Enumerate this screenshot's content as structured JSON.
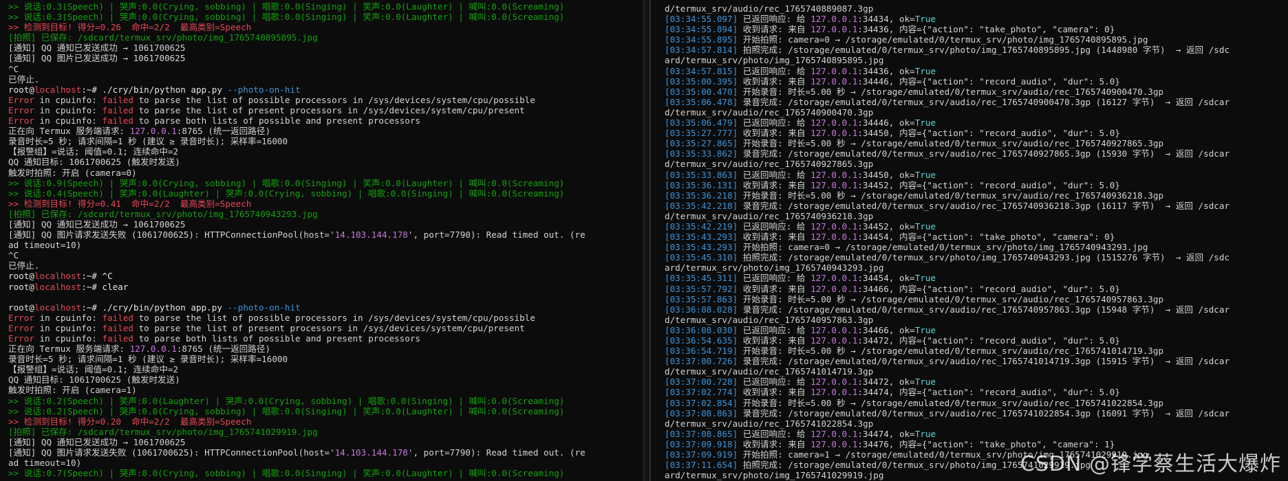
{
  "left": {
    "lines": [
      {
        "t": "g",
        "s": ">> 说话:0.3(Speech) | 哭声:0.0(Crying, sobbing) | 唱歌:0.0(Singing) | 笑声:0.0(Laughter) | 喊叫:0.0(Screaming)"
      },
      {
        "t": "g",
        "s": ">> 说话:0.3(Speech) | 哭声:0.0(Crying, sobbing) | 唱歌:0.0(Singing) | 笑声:0.0(Laughter) | 喊叫:0.0(Screaming)"
      },
      {
        "t": "r",
        "s": ">> 检测到目标! 得分=0.26  命中=2/2  最高类别=Speech"
      },
      {
        "t": "g",
        "s": "[拍照] 已保存: /sdcard/termux_srv/photo/img_1765740895895.jpg"
      },
      {
        "t": "w",
        "s": "[通知] QQ 通知已发送成功 → 1061700625"
      },
      {
        "t": "w",
        "s": "[通知] QQ 图片已发送成功 → 1061700625"
      },
      {
        "t": "w",
        "s": "^C"
      },
      {
        "t": "w",
        "s": "已停止."
      },
      {
        "t": "prompt",
        "user": "root",
        "host": "localhost",
        "path": ":~#",
        "cmd": " ./cry/bin/python app.py ",
        "flag": "--photo-on-hit"
      },
      {
        "t": "err",
        "s": " in cpuinfo: ",
        "f": "failed",
        "rest": " to parse the list of possible processors in /sys/devices/system/cpu/possible"
      },
      {
        "t": "err",
        "s": " in cpuinfo: ",
        "f": "failed",
        "rest": " to parse the list of present processors in /sys/devices/system/cpu/present"
      },
      {
        "t": "err",
        "s": " in cpuinfo: ",
        "f": "failed",
        "rest": " to parse both lists of possible and present processors"
      },
      {
        "t": "ip",
        "a": "正在向 Termux 服务端请求: ",
        "ip": "127.0.0.1",
        "b": ":8765 (统一返回路径)"
      },
      {
        "t": "w",
        "s": "录音时长=5 秒; 请求间隔=1 秒 (建议 ≥ 录音时长); 采样率=16000"
      },
      {
        "t": "w",
        "s": "【报警组】=说话; 阈值=0.1; 连续命中=2"
      },
      {
        "t": "w",
        "s": "QQ 通知目标: 1061700625 (触发时发送)"
      },
      {
        "t": "w",
        "s": "触发时拍照: 开启 (camera=0)"
      },
      {
        "t": "g",
        "s": ">> 说话:0.9(Speech) | 哭声:0.0(Crying, sobbing) | 唱歌:0.0(Singing) | 笑声:0.0(Laughter) | 喊叫:0.0(Screaming)"
      },
      {
        "t": "g",
        "s": ">> 说话:0.4(Speech) | 笑声:0.0(Laughter) | 哭声:0.0(Crying, sobbing) | 唱歌:0.0(Singing) | 喊叫:0.0(Screaming)"
      },
      {
        "t": "r",
        "s": ">> 检测到目标! 得分=0.41  命中=2/2  最高类别=Speech"
      },
      {
        "t": "g",
        "s": "[拍照] 已保存: /sdcard/termux_srv/photo/img_1765740943293.jpg"
      },
      {
        "t": "w",
        "s": "[通知] QQ 通知已发送成功 → 1061700625"
      },
      {
        "t": "ip2",
        "a": "[通知] QQ 图片请求发送失败 (1061700625): HTTPConnectionPool(host='",
        "ip": "14.103.144.178",
        "b": "', port=7790): Read timed out. (re"
      },
      {
        "t": "w",
        "s": "ad timeout=10)"
      },
      {
        "t": "w",
        "s": "^C"
      },
      {
        "t": "w",
        "s": "已停止."
      },
      {
        "t": "prompt0",
        "user": "root",
        "host": "localhost",
        "path": ":~#",
        "cmd": " ^C"
      },
      {
        "t": "prompt0",
        "user": "root",
        "host": "localhost",
        "path": ":~#",
        "cmd": " clear"
      },
      {
        "t": "w",
        "s": ""
      },
      {
        "t": "prompt",
        "user": "root",
        "host": "localhost",
        "path": ":~#",
        "cmd": " ./cry/bin/python app.py ",
        "flag": "--photo-on-hit"
      },
      {
        "t": "err",
        "s": " in cpuinfo: ",
        "f": "failed",
        "rest": " to parse the list of possible processors in /sys/devices/system/cpu/possible"
      },
      {
        "t": "err",
        "s": " in cpuinfo: ",
        "f": "failed",
        "rest": " to parse the list of present processors in /sys/devices/system/cpu/present"
      },
      {
        "t": "err",
        "s": " in cpuinfo: ",
        "f": "failed",
        "rest": " to parse both lists of possible and present processors"
      },
      {
        "t": "ip",
        "a": "正在向 Termux 服务端请求: ",
        "ip": "127.0.0.1",
        "b": ":8765 (统一返回路径)"
      },
      {
        "t": "w",
        "s": "录音时长=5 秒; 请求间隔=1 秒 (建议 ≥ 录音时长); 采样率=16000"
      },
      {
        "t": "w",
        "s": "【报警组】=说话; 阈值=0.1; 连续命中=2"
      },
      {
        "t": "w",
        "s": "QQ 通知目标: 1061700625 (触发时发送)"
      },
      {
        "t": "w",
        "s": "触发时拍照: 开启 (camera=1)"
      },
      {
        "t": "g",
        "s": ">> 说话:0.2(Speech) | 笑声:0.0(Laughter) | 哭声:0.0(Crying, sobbing) | 唱歌:0.0(Singing) | 喊叫:0.0(Screaming)"
      },
      {
        "t": "g",
        "s": ">> 说话:0.2(Speech) | 哭声:0.0(Crying, sobbing) | 唱歌:0.0(Singing) | 笑声:0.0(Laughter) | 喊叫:0.0(Screaming)"
      },
      {
        "t": "r",
        "s": ">> 检测到目标! 得分=0.20  命中=2/2  最高类别=Speech"
      },
      {
        "t": "g",
        "s": "[拍照] 已保存: /sdcard/termux_srv/photo/img_1765741029919.jpg"
      },
      {
        "t": "w",
        "s": "[通知] QQ 通知已发送成功 → 1061700625"
      },
      {
        "t": "ip2",
        "a": "[通知] QQ 图片请求发送失败 (1061700625): HTTPConnectionPool(host='",
        "ip": "14.103.144.178",
        "b": "', port=7790): Read timed out. (re"
      },
      {
        "t": "w",
        "s": "ad timeout=10)"
      },
      {
        "t": "g",
        "s": ">> 说话:0.7(Speech) | 哭声:0.0(Crying, sobbing) | 唱歌:0.0(Singing) | 笑声:0.0(Laughter) | 喊叫:0.0(Screaming)"
      }
    ]
  },
  "right": {
    "lines": [
      {
        "t": "w",
        "s": "d/termux_srv/audio/rec_1765740889087.3gp"
      },
      {
        "t": "log",
        "ts": "[03:34:55.097]",
        "a": " 已返回响应: 给 ",
        "ip": "127.0.0.1",
        "b": ":34434, ok=",
        "ok": "True"
      },
      {
        "t": "log",
        "ts": "[03:34:55.894]",
        "a": " 收到请求: 来自 ",
        "ip": "127.0.0.1",
        "b": ":34436, 内容={\"action\": \"take_photo\", \"camera\": 0}"
      },
      {
        "t": "log",
        "ts": "[03:34:55.895]",
        "a": " 开始拍照: camera=0 → /storage/emulated/0/termux_srv/photo/img_1765740895895.jpg"
      },
      {
        "t": "log",
        "ts": "[03:34:57.814]",
        "a": " 拍照完成: /storage/emulated/0/termux_srv/photo/img_1765740895895.jpg (1448980 字节)  → 返回 /sdc"
      },
      {
        "t": "w",
        "s": "ard/termux_srv/photo/img_1765740895895.jpg"
      },
      {
        "t": "log",
        "ts": "[03:34:57.815]",
        "a": " 已返回响应: 给 ",
        "ip": "127.0.0.1",
        "b": ":34436, ok=",
        "ok": "True"
      },
      {
        "t": "log",
        "ts": "[03:35:00.395]",
        "a": " 收到请求: 来自 ",
        "ip": "127.0.0.1",
        "b": ":34446, 内容={\"action\": \"record_audio\", \"dur\": 5.0}"
      },
      {
        "t": "log",
        "ts": "[03:35:00.470]",
        "a": " 开始录音: 时长=5.00 秒 → /storage/emulated/0/termux_srv/audio/rec_1765740900470.3gp"
      },
      {
        "t": "log",
        "ts": "[03:35:06.478]",
        "a": " 录音完成: /storage/emulated/0/termux_srv/audio/rec_1765740900470.3gp (16127 字节)  → 返回 /sdcar"
      },
      {
        "t": "w",
        "s": "d/termux_srv/audio/rec_1765740900470.3gp"
      },
      {
        "t": "log",
        "ts": "[03:35:06.479]",
        "a": " 已返回响应: 给 ",
        "ip": "127.0.0.1",
        "b": ":34446, ok=",
        "ok": "True"
      },
      {
        "t": "log",
        "ts": "[03:35:27.777]",
        "a": " 收到请求: 来自 ",
        "ip": "127.0.0.1",
        "b": ":34450, 内容={\"action\": \"record_audio\", \"dur\": 5.0}"
      },
      {
        "t": "log",
        "ts": "[03:35:27.865]",
        "a": " 开始录音: 时长=5.00 秒 → /storage/emulated/0/termux_srv/audio/rec_1765740927865.3gp"
      },
      {
        "t": "log",
        "ts": "[03:35:33.862]",
        "a": " 录音完成: /storage/emulated/0/termux_srv/audio/rec_1765740927865.3gp (15930 字节)  → 返回 /sdcar"
      },
      {
        "t": "w",
        "s": "d/termux_srv/audio/rec_1765740927865.3gp"
      },
      {
        "t": "log",
        "ts": "[03:35:33.863]",
        "a": " 已返回响应: 给 ",
        "ip": "127.0.0.1",
        "b": ":34450, ok=",
        "ok": "True"
      },
      {
        "t": "log",
        "ts": "[03:35:36.131]",
        "a": " 收到请求: 来自 ",
        "ip": "127.0.0.1",
        "b": ":34452, 内容={\"action\": \"record_audio\", \"dur\": 5.0}"
      },
      {
        "t": "log",
        "ts": "[03:35:36.218]",
        "a": " 开始录音: 时长=5.00 秒 → /storage/emulated/0/termux_srv/audio/rec_1765740936218.3gp"
      },
      {
        "t": "log",
        "ts": "[03:35:42.218]",
        "a": " 录音完成: /storage/emulated/0/termux_srv/audio/rec_1765740936218.3gp (16117 字节)  → 返回 /sdcar"
      },
      {
        "t": "w",
        "s": "d/termux_srv/audio/rec_1765740936218.3gp"
      },
      {
        "t": "log",
        "ts": "[03:35:42.219]",
        "a": " 已返回响应: 给 ",
        "ip": "127.0.0.1",
        "b": ":34452, ok=",
        "ok": "True"
      },
      {
        "t": "log",
        "ts": "[03:35:43.293]",
        "a": " 收到请求: 来自 ",
        "ip": "127.0.0.1",
        "b": ":34454, 内容={\"action\": \"take_photo\", \"camera\": 0}"
      },
      {
        "t": "log",
        "ts": "[03:35:43.293]",
        "a": " 开始拍照: camera=0 → /storage/emulated/0/termux_srv/photo/img_1765740943293.jpg"
      },
      {
        "t": "log",
        "ts": "[03:35:45.310]",
        "a": " 拍照完成: /storage/emulated/0/termux_srv/photo/img_1765740943293.jpg (1515276 字节)  → 返回 /sdc"
      },
      {
        "t": "w",
        "s": "ard/termux_srv/photo/img_1765740943293.jpg"
      },
      {
        "t": "log",
        "ts": "[03:35:45.311]",
        "a": " 已返回响应: 给 ",
        "ip": "127.0.0.1",
        "b": ":34454, ok=",
        "ok": "True"
      },
      {
        "t": "log",
        "ts": "[03:35:57.792]",
        "a": " 收到请求: 来自 ",
        "ip": "127.0.0.1",
        "b": ":34466, 内容={\"action\": \"record_audio\", \"dur\": 5.0}"
      },
      {
        "t": "log",
        "ts": "[03:35:57.863]",
        "a": " 开始录音: 时长=5.00 秒 → /storage/emulated/0/termux_srv/audio/rec_1765740957863.3gp"
      },
      {
        "t": "log",
        "ts": "[03:36:08.028]",
        "a": " 录音完成: /storage/emulated/0/termux_srv/audio/rec_1765740957863.3gp (15948 字节)  → 返回 /sdcar"
      },
      {
        "t": "w",
        "s": "d/termux_srv/audio/rec_1765740957863.3gp"
      },
      {
        "t": "log",
        "ts": "[03:36:08.030]",
        "a": " 已返回响应: 给 ",
        "ip": "127.0.0.1",
        "b": ":34466, ok=",
        "ok": "True"
      },
      {
        "t": "log",
        "ts": "[03:36:54.635]",
        "a": " 收到请求: 来自 ",
        "ip": "127.0.0.1",
        "b": ":34472, 内容={\"action\": \"record_audio\", \"dur\": 5.0}"
      },
      {
        "t": "log",
        "ts": "[03:36:54.719]",
        "a": " 开始录音: 时长=5.00 秒 → /storage/emulated/0/termux_srv/audio/rec_1765741014719.3gp"
      },
      {
        "t": "log",
        "ts": "[03:37:00.726]",
        "a": " 录音完成: /storage/emulated/0/termux_srv/audio/rec_1765741014719.3gp (15915 字节)  → 返回 /sdcar"
      },
      {
        "t": "w",
        "s": "d/termux_srv/audio/rec_1765741014719.3gp"
      },
      {
        "t": "log",
        "ts": "[03:37:00.728]",
        "a": " 已返回响应: 给 ",
        "ip": "127.0.0.1",
        "b": ":34472, ok=",
        "ok": "True"
      },
      {
        "t": "log",
        "ts": "[03:37:02.774]",
        "a": " 收到请求: 来自 ",
        "ip": "127.0.0.1",
        "b": ":34474, 内容={\"action\": \"record_audio\", \"dur\": 5.0}"
      },
      {
        "t": "log",
        "ts": "[03:37:02.854]",
        "a": " 开始录音: 时长=5.00 秒 → /storage/emulated/0/termux_srv/audio/rec_1765741022854.3gp"
      },
      {
        "t": "log",
        "ts": "[03:37:08.863]",
        "a": " 录音完成: /storage/emulated/0/termux_srv/audio/rec_1765741022854.3gp (16091 字节)  → 返回 /sdcar"
      },
      {
        "t": "w",
        "s": "d/termux_srv/audio/rec_1765741022854.3gp"
      },
      {
        "t": "log",
        "ts": "[03:37:08.865]",
        "a": " 已返回响应: 给 ",
        "ip": "127.0.0.1",
        "b": ":34474, ok=",
        "ok": "True"
      },
      {
        "t": "log",
        "ts": "[03:37:09.918]",
        "a": " 收到请求: 来自 ",
        "ip": "127.0.0.1",
        "b": ":34476, 内容={\"action\": \"take_photo\", \"camera\": 1}"
      },
      {
        "t": "log",
        "ts": "[03:37:09.919]",
        "a": " 开始拍照: camera=1 → /storage/emulated/0/termux_srv/photo/img_1765741029919.jpg"
      },
      {
        "t": "log",
        "ts": "[03:37:11.654]",
        "a": " 拍照完成: /storage/emulated/0/termux_srv/photo/img_1765741029919.jpg"
      },
      {
        "t": "w",
        "s": "ard/termux_srv/photo/img_1765741029919.jpg"
      }
    ]
  },
  "watermark": "CSDN @锋学蔡生活大爆炸",
  "labels": {
    "error": "Error"
  }
}
